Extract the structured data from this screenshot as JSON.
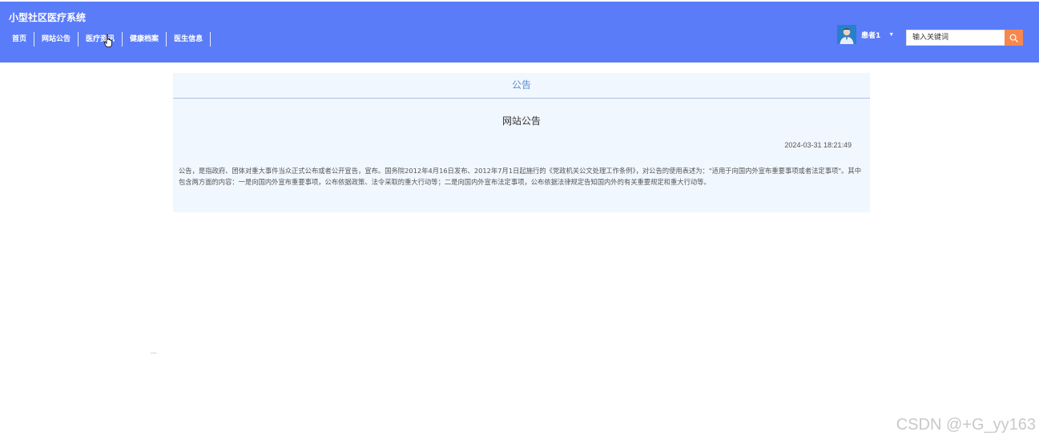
{
  "header": {
    "brand": "小型社区医疗系统",
    "nav": [
      "首页",
      "网站公告",
      "医疗资讯",
      "健康档案",
      "医生信息"
    ],
    "user_name": "患者1",
    "search_placeholder": "输入关键词"
  },
  "panel": {
    "heading": "公告",
    "title": "网站公告",
    "date": "2024-03-31 18:21:49",
    "body": "公告，是指政府、团体对重大事件当众正式公布或者公开宣告，宣布。国务院2012年4月16日发布、2012年7月1日起施行的《党政机关公文处理工作条例》，对公告的使用表述为：\"适用于向国内外宣布重要事项或者法定事项\"。其中包含两方面的内容：一是向国内外宣布重要事项，公布依据政策、法令采取的重大行动等；二是向国内外宣布法定事项，公布依据法律规定告知国内外的有关重要规定和重大行动等。"
  },
  "misc": {
    "dots": "....",
    "watermark": "CSDN @+G_yy163"
  },
  "colors": {
    "header_bg": "#5a7cf9",
    "search_button": "#f7874d",
    "panel_bg": "#f1f7fe",
    "panel_heading": "#5b8bd6"
  }
}
